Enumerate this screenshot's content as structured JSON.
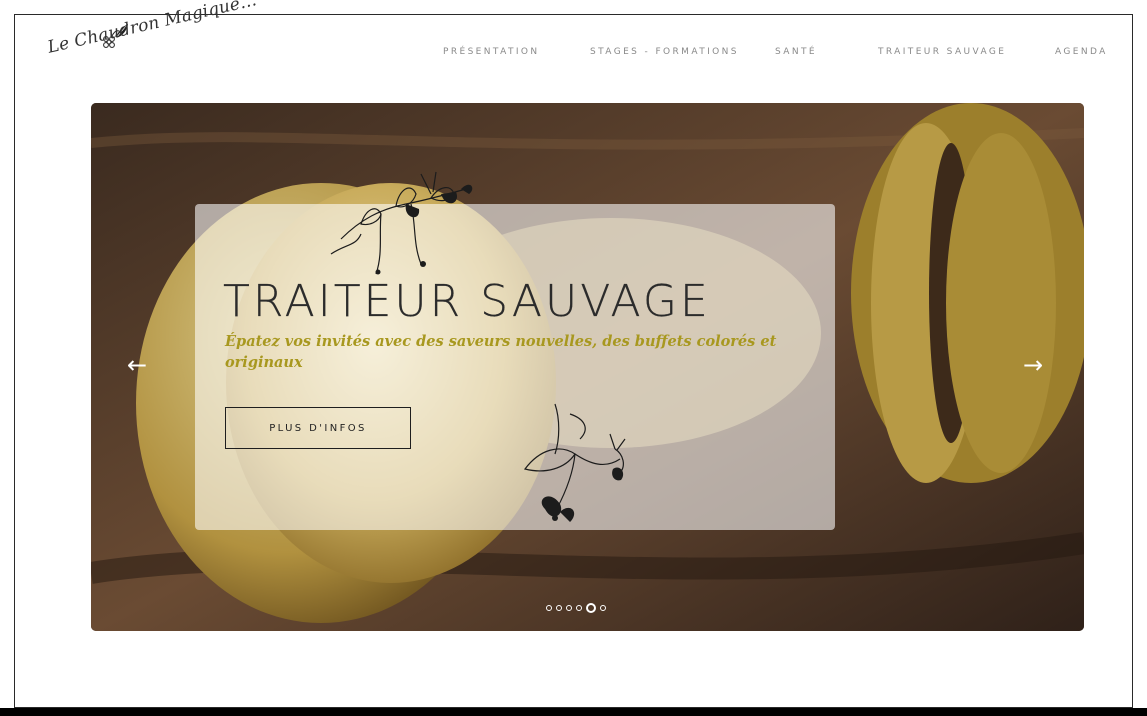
{
  "logo": {
    "text": "Le Chaudron Magique..."
  },
  "nav": {
    "items": [
      {
        "label": "PRÉSENTATION"
      },
      {
        "label": "STAGES - FORMATIONS"
      },
      {
        "label": "SANTÉ"
      },
      {
        "label": "TRAITEUR SAUVAGE"
      },
      {
        "label": "AGENDA"
      }
    ]
  },
  "slider": {
    "title": "TRAITEUR SAUVAGE",
    "subtitle": "Épatez vos invités avec des saveurs nouvelles, des buffets colorés et originaux",
    "button_label": "PLUS D'INFOS",
    "prev_arrow": "←",
    "next_arrow": "→",
    "slide_count": 6,
    "active_slide": 5
  },
  "colors": {
    "subtitle": "#a8981f",
    "nav_text": "#8a8a8a",
    "caption_bg": "rgba(255,255,255,0.58)"
  },
  "icons": {
    "logo_mark": "flower-leaf-icon",
    "prev": "arrow-left-icon",
    "next": "arrow-right-icon"
  }
}
